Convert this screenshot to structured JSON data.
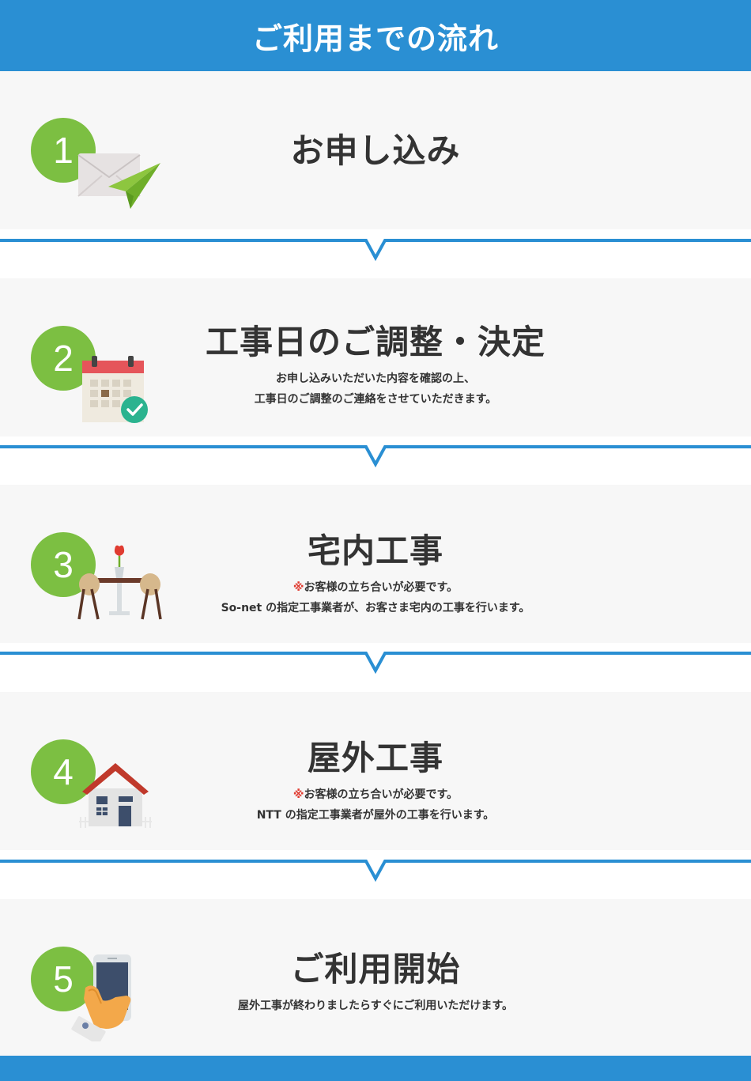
{
  "header": {
    "title": "ご利用までの流れ"
  },
  "steps": [
    {
      "number": "1",
      "title": "お申し込み",
      "icon": "envelope-paper-plane-icon"
    },
    {
      "number": "2",
      "title": "工事日のご調整・決定",
      "icon": "calendar-check-icon",
      "desc1": "お申し込みいただいた内容を確認の上、",
      "desc2": "工事日のご調整のご連絡をさせていただきます。"
    },
    {
      "number": "3",
      "title": "宅内工事",
      "icon": "dining-table-icon",
      "note_mark": "※",
      "note": "お客様の立ち合いが必要です。",
      "desc2": "So-net の指定工事業者が、お客さま宅内の工事を行います。"
    },
    {
      "number": "4",
      "title": "屋外工事",
      "icon": "house-icon",
      "note_mark": "※",
      "note": "お客様の立ち合いが必要です。",
      "desc2": "NTT の指定工事業者が屋外の工事を行います。"
    },
    {
      "number": "5",
      "title": "ご利用開始",
      "icon": "smartphone-hand-icon",
      "desc1": "屋外工事が終わりましたらすぐにご利用いただけます。"
    }
  ],
  "colors": {
    "brand_blue": "#2a8fd3",
    "step_green": "#7cbf42",
    "note_red": "#e03c31",
    "panel_bg": "#f7f7f7"
  }
}
